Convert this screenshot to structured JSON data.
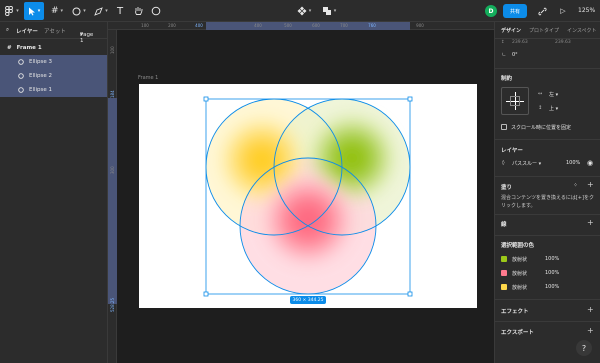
{
  "toolbar": {
    "avatar_initial": "D",
    "share_label": "共有",
    "zoom_level": "125%"
  },
  "left_panel": {
    "tab_layers": "レイヤー",
    "tab_assets": "アセット",
    "page_name": "Page 1",
    "layers": [
      {
        "name": "Frame 1",
        "type": "frame"
      },
      {
        "name": "Ellipse 3",
        "type": "ellipse"
      },
      {
        "name": "Ellipse 2",
        "type": "ellipse"
      },
      {
        "name": "Ellipse 1",
        "type": "ellipse"
      }
    ]
  },
  "rulers": {
    "top": [
      "100",
      "200",
      "300",
      "400",
      "500",
      "600",
      "700",
      "800",
      "900"
    ],
    "top_highlight": [
      "400",
      "760"
    ],
    "left": [
      "100",
      "200",
      "300",
      "400"
    ],
    "left_highlight": [
      "184",
      "528.25"
    ]
  },
  "canvas": {
    "frame_label": "Frame 1",
    "selection_dims": "360 × 344.25"
  },
  "right_panel": {
    "tab_design": "デザイン",
    "tab_prototype": "プロトタイプ",
    "tab_inspect": "インスペクト",
    "coord_x": "239.63",
    "coord_y": "239.63",
    "rotation": "0°",
    "constraints_title": "制約",
    "constraint_h": "左",
    "constraint_v": "上",
    "fix_scroll_label": "スクロール時に位置を固定",
    "layer_title": "レイヤー",
    "pass_through": "パススルー",
    "layer_opacity": "100%",
    "fill_title": "塗り",
    "fill_hint": "混合コンテンツを置き換えるには[+]をクリックします。",
    "stroke_title": "線",
    "selection_colors_title": "選択範囲の色",
    "selection_colors": [
      {
        "label": "放射状",
        "opacity": "100%",
        "color": "#9cc919"
      },
      {
        "label": "放射状",
        "opacity": "100%",
        "color": "#ff7a8e"
      },
      {
        "label": "放射状",
        "opacity": "100%",
        "color": "#ffd84a"
      }
    ],
    "effects_title": "エフェクト",
    "export_title": "エクスポート",
    "help": "?"
  },
  "colors": {
    "accent": "#0c8ce9",
    "yellow": "#ffd23f",
    "green": "#8dbf1a",
    "pink": "#ff5c7a",
    "selection_row": "#4a5578"
  }
}
